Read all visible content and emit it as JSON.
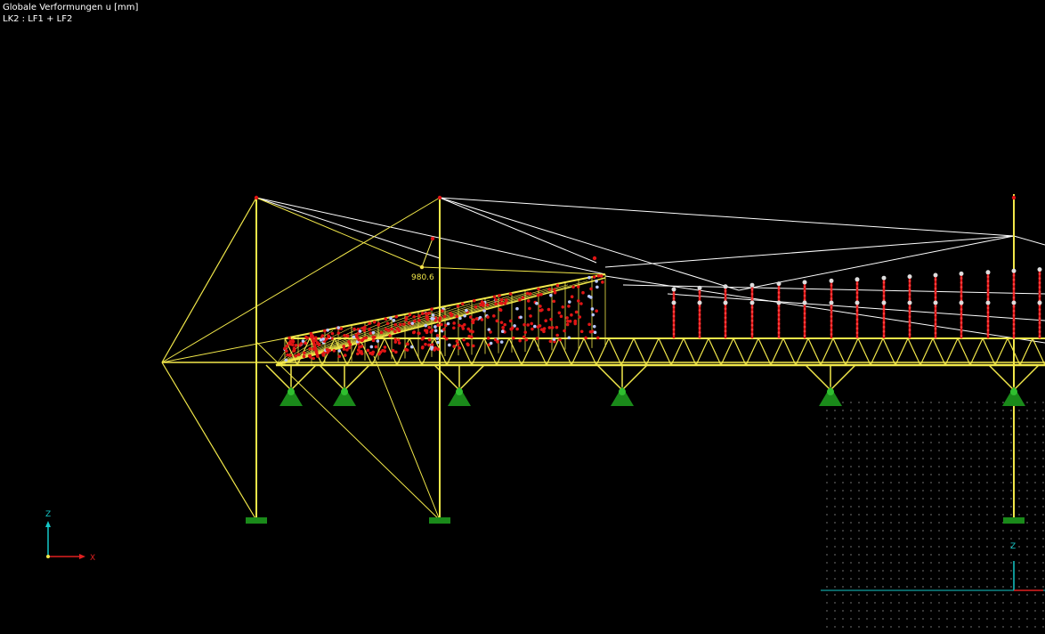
{
  "header": {
    "title": "Globale Verformungen u [mm]",
    "load_case": "LK2 : LF1 + LF2"
  },
  "annotation": {
    "max_deformation": "980.6"
  },
  "axes_main": {
    "z_label": "Z",
    "x_label": "X"
  },
  "axes_mini": {
    "z_label": "Z"
  },
  "colors": {
    "background": "#000000",
    "structure": "#f2e84a",
    "cable": "#ffffff",
    "node": "#e01515",
    "support": "#1a8a1a",
    "axis_z": "#14c8c8",
    "axis_x": "#e02020",
    "grid_dot": "#8a8a8a"
  }
}
